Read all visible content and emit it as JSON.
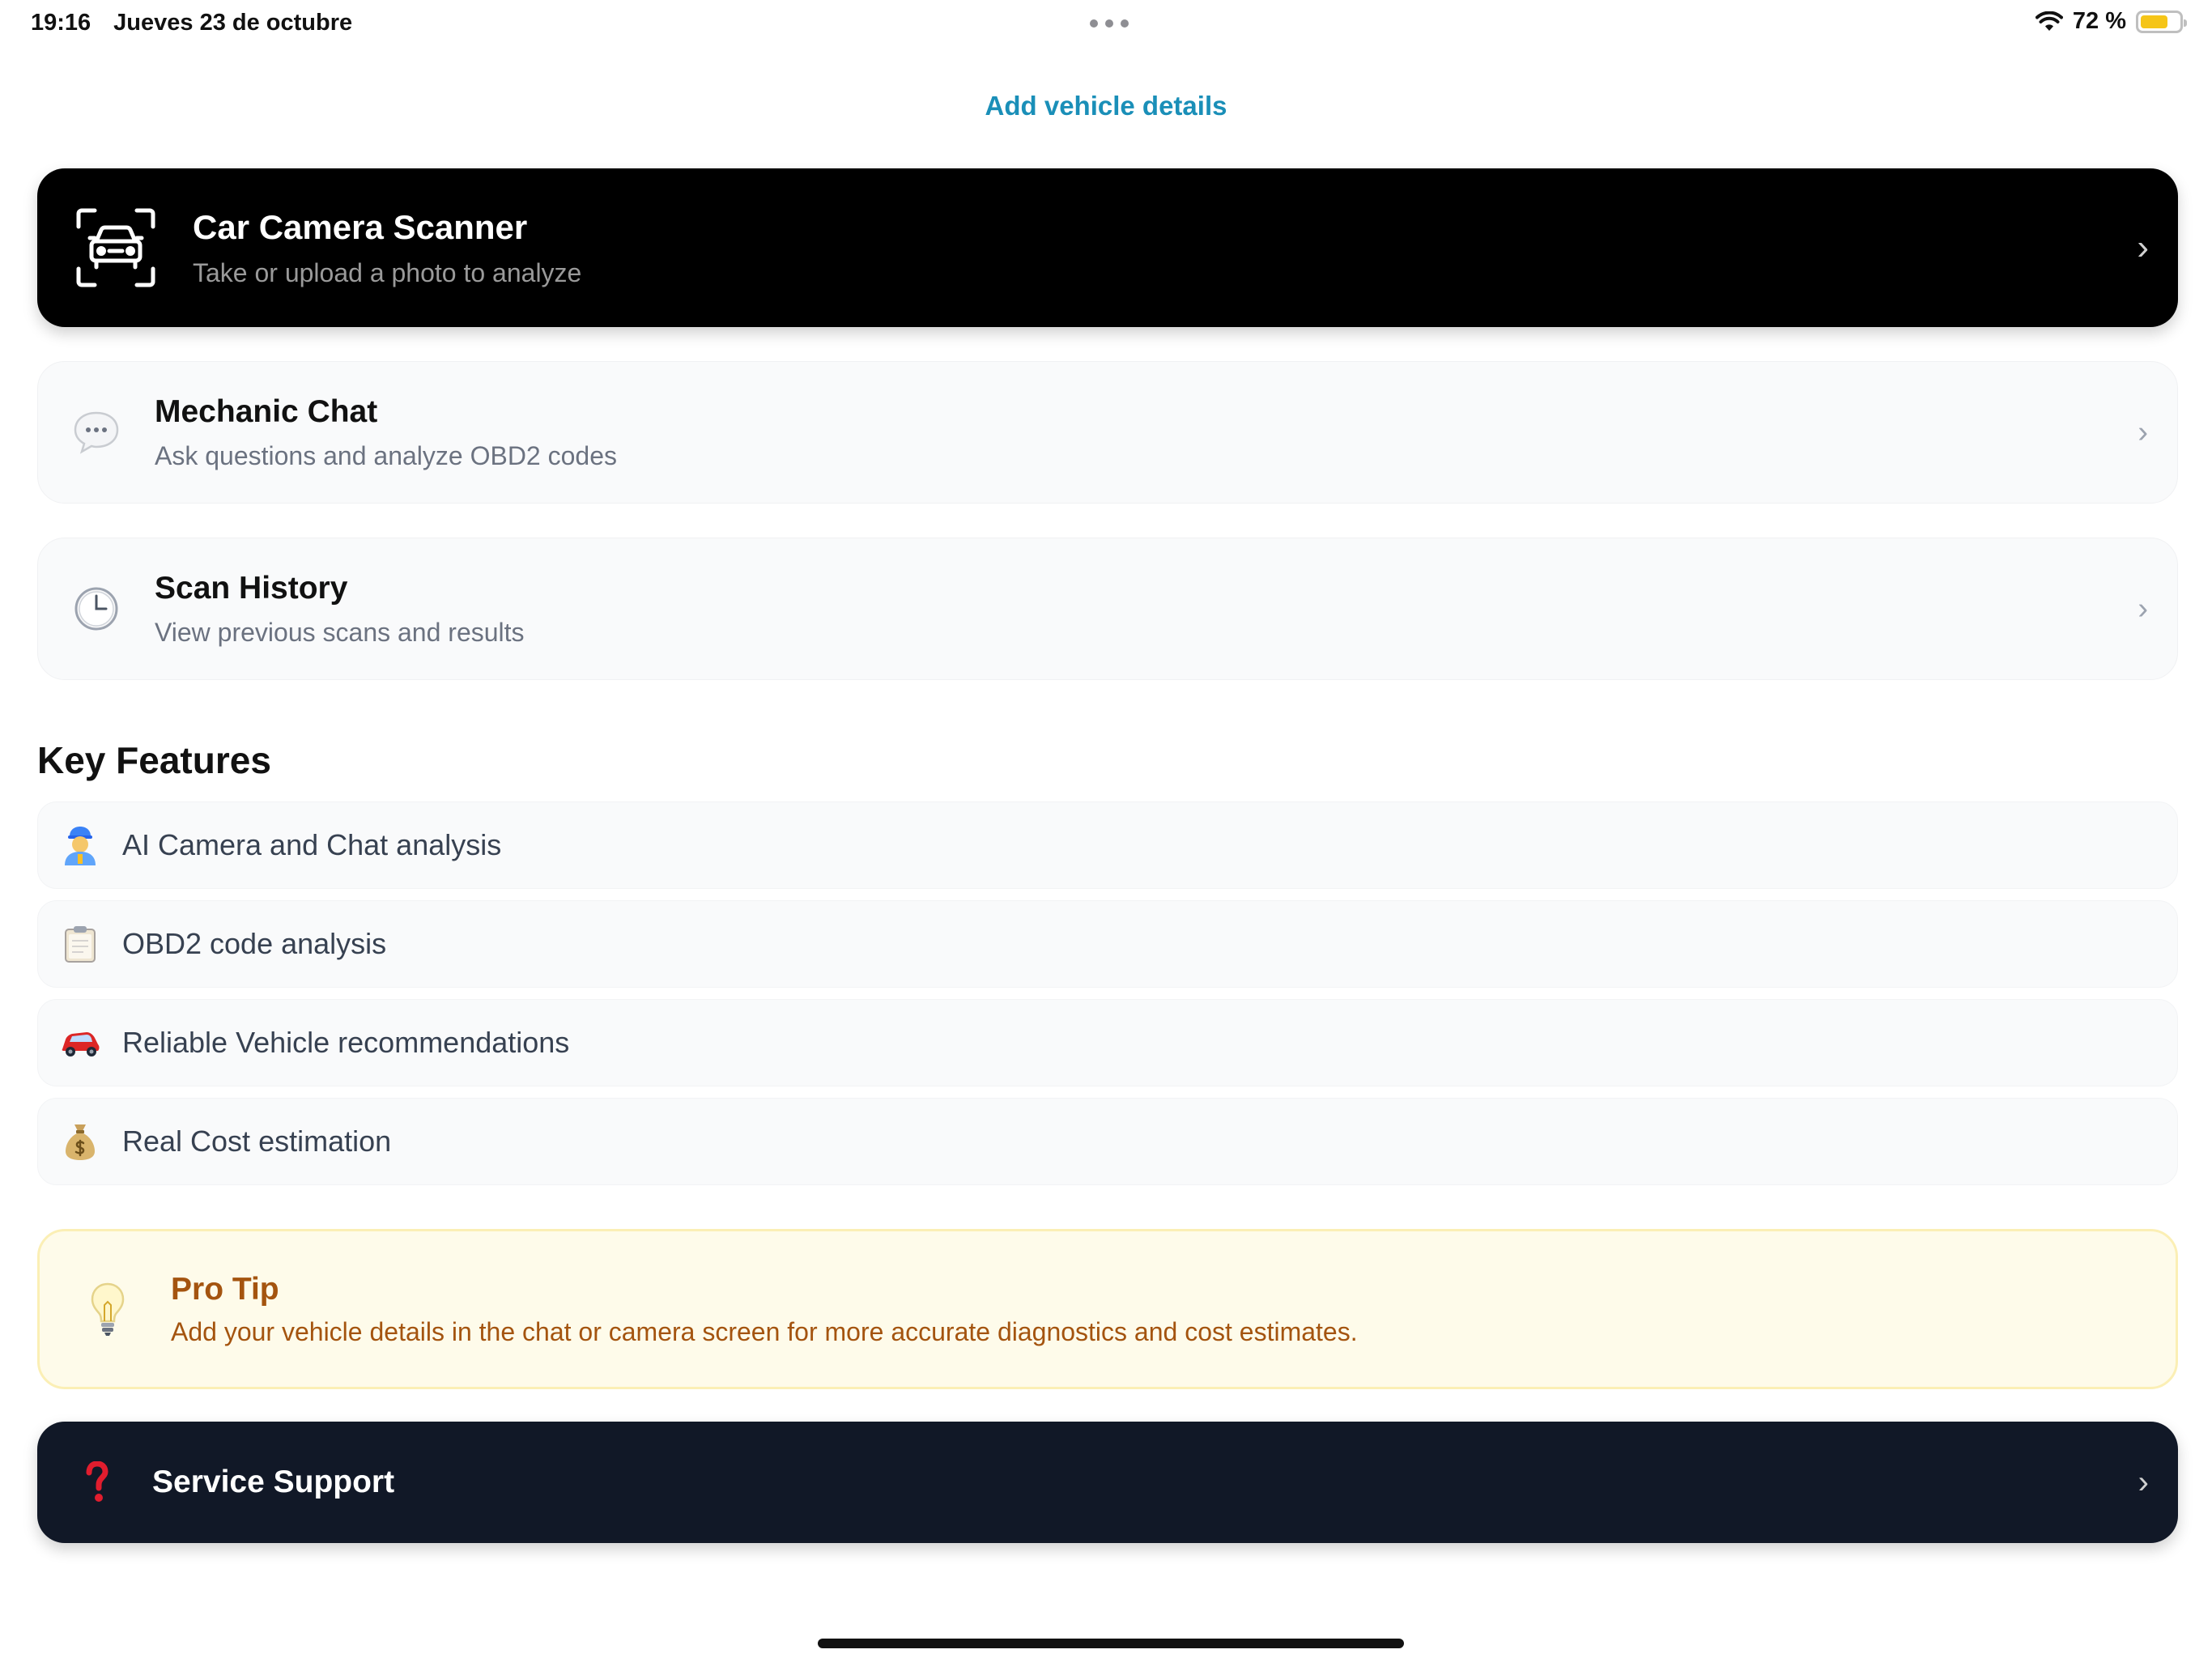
{
  "status_bar": {
    "time": "19:16",
    "date": "Jueves 23 de octubre",
    "battery_text": "72 %",
    "battery_level": 0.72,
    "battery_color": "#f5c518"
  },
  "header": {
    "link_label": "Add vehicle details",
    "link_color": "#1a8fb8"
  },
  "cards": {
    "scanner": {
      "title": "Car Camera Scanner",
      "subtitle": "Take or upload a photo to analyze",
      "icon": "car-scan-icon"
    },
    "mechanic_chat": {
      "title": "Mechanic Chat",
      "subtitle": "Ask questions and analyze OBD2 codes",
      "icon": "chat-bubble-icon"
    },
    "scan_history": {
      "title": "Scan History",
      "subtitle": "View previous scans and results",
      "icon": "clock-icon"
    },
    "chevron": "›"
  },
  "key_features": {
    "title": "Key Features",
    "items": [
      {
        "label": "AI Camera and Chat analysis",
        "icon": "mechanic-emoji-icon"
      },
      {
        "label": "OBD2 code analysis",
        "icon": "clipboard-emoji-icon"
      },
      {
        "label": "Reliable Vehicle recommendations",
        "icon": "red-car-emoji-icon"
      },
      {
        "label": "Real Cost estimation",
        "icon": "money-bag-emoji-icon"
      }
    ]
  },
  "pro_tip": {
    "title": "Pro Tip",
    "text": "Add your vehicle details in the chat or camera screen for more accurate diagnostics and cost estimates.",
    "icon": "lightbulb-icon"
  },
  "support": {
    "label": "Service Support",
    "icon": "question-mark-icon"
  },
  "colors": {
    "primary_card": "#000000",
    "support_card": "#111827",
    "tip_background": "#fefbea",
    "tip_text": "#a4540f"
  }
}
